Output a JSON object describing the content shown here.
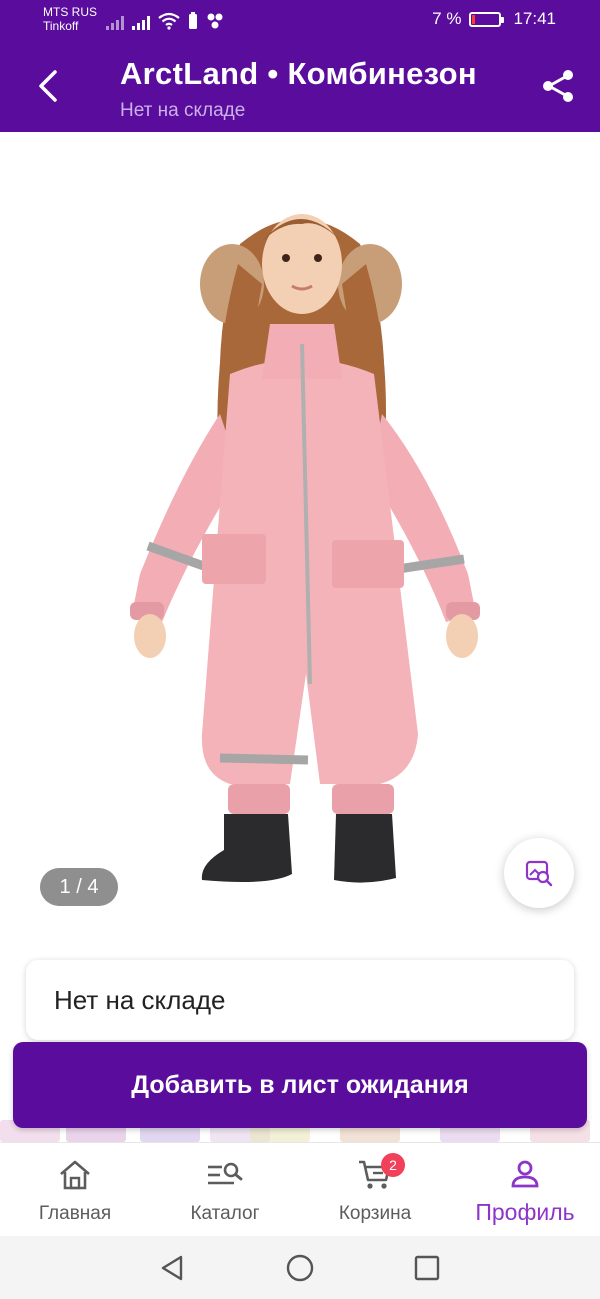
{
  "status_bar": {
    "carrier_1": "MTS RUS",
    "carrier_2": "Tinkoff",
    "battery_percent": "7 %",
    "time": "17:41",
    "battery_level": 0.07
  },
  "app_bar": {
    "title": "ArctLand • Комбинезон",
    "subtitle": "Нет на складе",
    "back_icon": "chevron-left-icon",
    "share_icon": "share-icon"
  },
  "gallery": {
    "counter": "1 / 4",
    "visual_search_icon": "image-search-icon"
  },
  "stock_card": {
    "text": "Нет на складе"
  },
  "wait_button": {
    "label": "Добавить в лист ожидания"
  },
  "bottom_nav": {
    "items": [
      {
        "label": "Главная",
        "icon": "home-icon"
      },
      {
        "label": "Каталог",
        "icon": "catalog-search-icon"
      },
      {
        "label": "Корзина",
        "icon": "cart-icon",
        "badge": "2"
      },
      {
        "label": "Профиль",
        "icon": "profile-icon",
        "active": true
      }
    ]
  },
  "colors": {
    "brand": "#5a0c9c",
    "active_nav": "#8e35c9",
    "badge": "#f0405a",
    "product": "#f2aeb4"
  }
}
